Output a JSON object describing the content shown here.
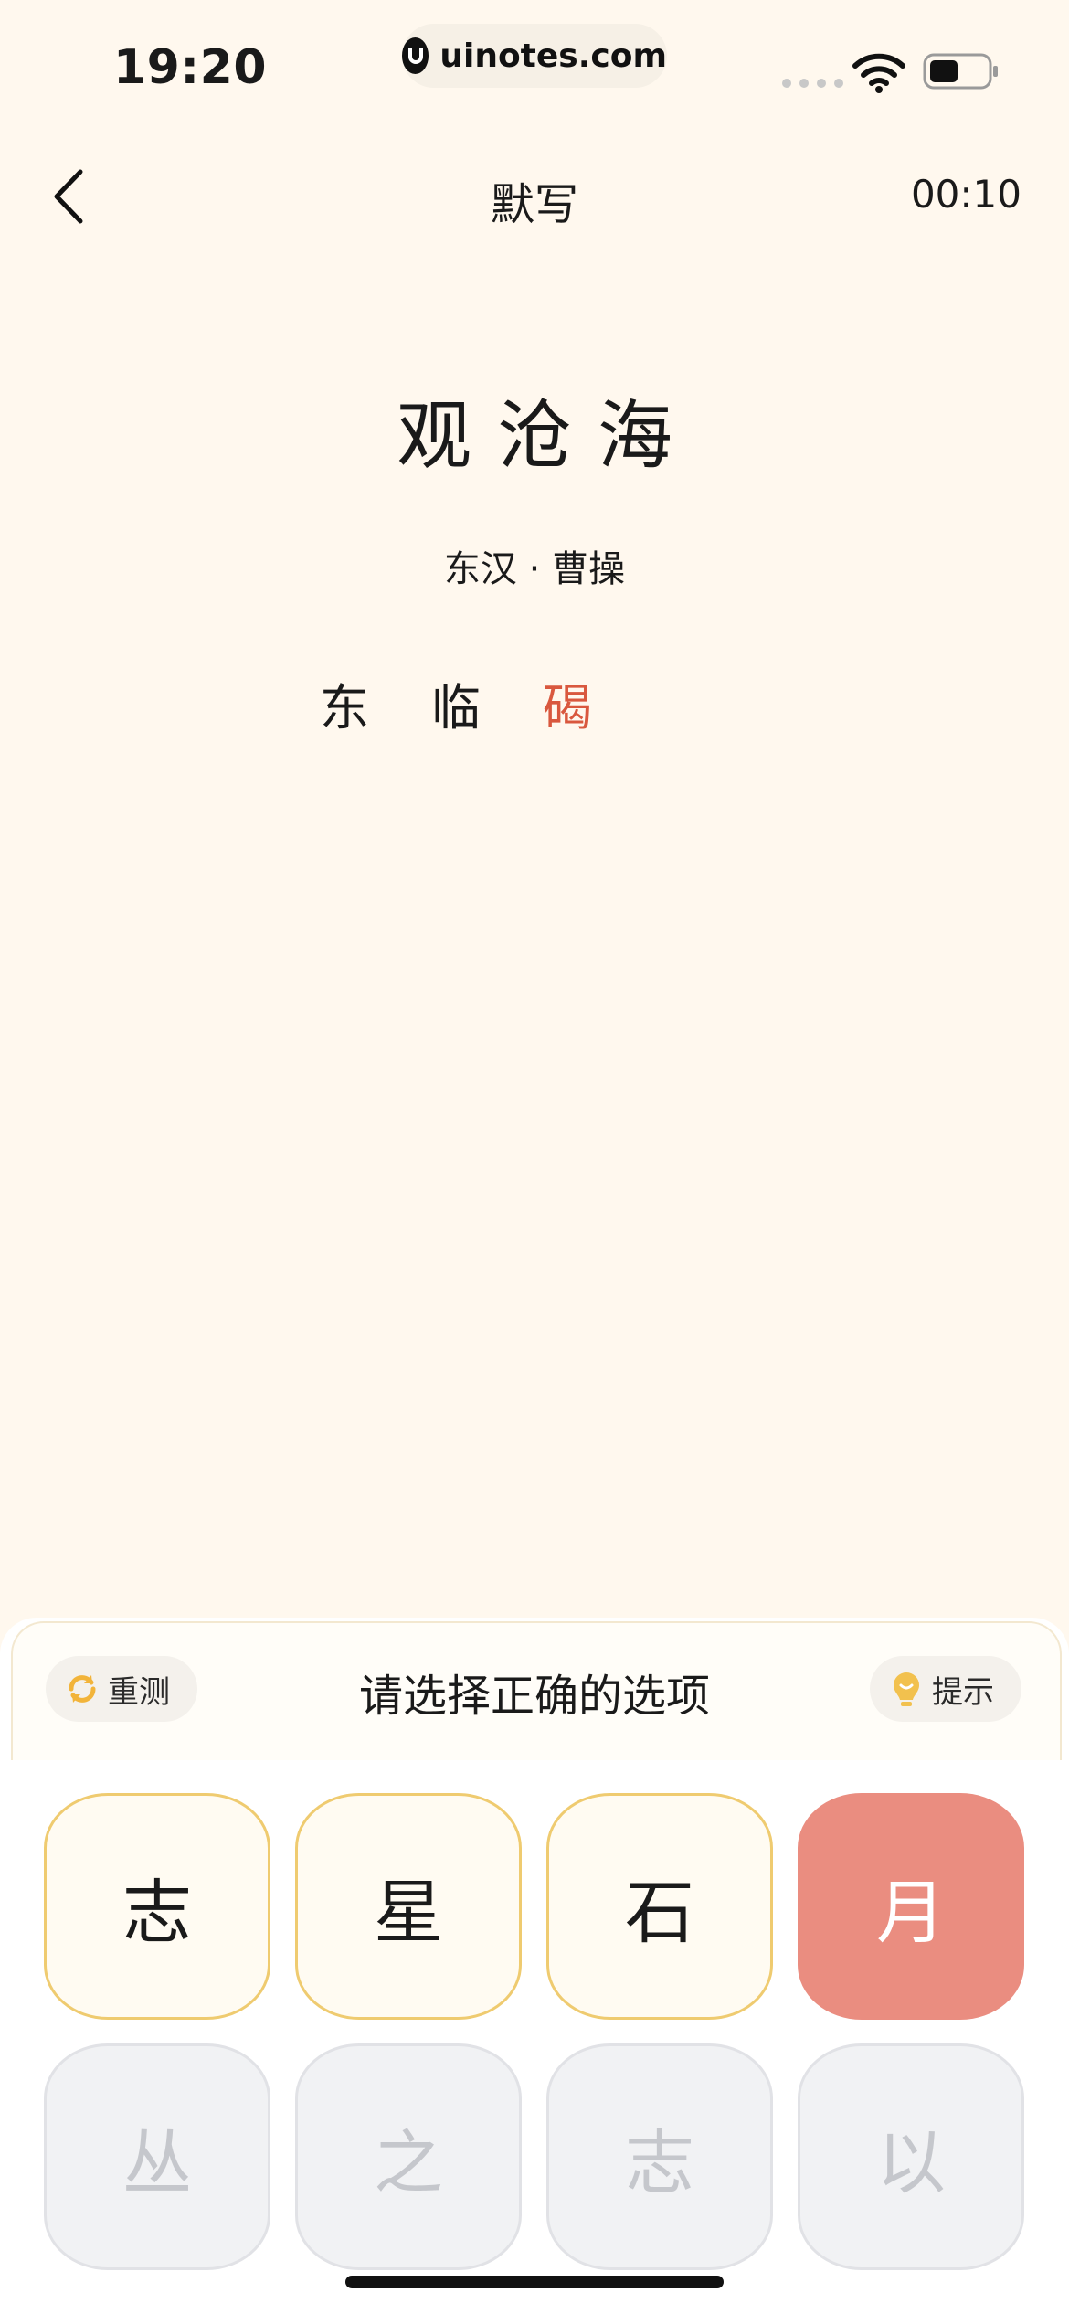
{
  "status_bar": {
    "time": "19:20",
    "url": "uinotes.com"
  },
  "nav": {
    "title": "默写",
    "timer": "00:10"
  },
  "poem": {
    "title": "观沧海",
    "author": "东汉 · 曹操",
    "line_chars": [
      {
        "char": "东",
        "state": "filled"
      },
      {
        "char": "临",
        "state": "filled"
      },
      {
        "char": "碣",
        "state": "hint"
      }
    ]
  },
  "panel": {
    "retest_label": "重测",
    "prompt": "请选择正确的选项",
    "hint_label": "提示",
    "options": [
      {
        "char": "志",
        "state": "active"
      },
      {
        "char": "星",
        "state": "active"
      },
      {
        "char": "石",
        "state": "active"
      },
      {
        "char": "月",
        "state": "selected"
      },
      {
        "char": "丛",
        "state": "used"
      },
      {
        "char": "之",
        "state": "used"
      },
      {
        "char": "志",
        "state": "used"
      },
      {
        "char": "以",
        "state": "used"
      }
    ]
  },
  "colors": {
    "background": "#FFF8EE",
    "accent_yellow": "#EFCB70",
    "selected_red": "#EA8D80",
    "hint_text": "#D9583E"
  }
}
